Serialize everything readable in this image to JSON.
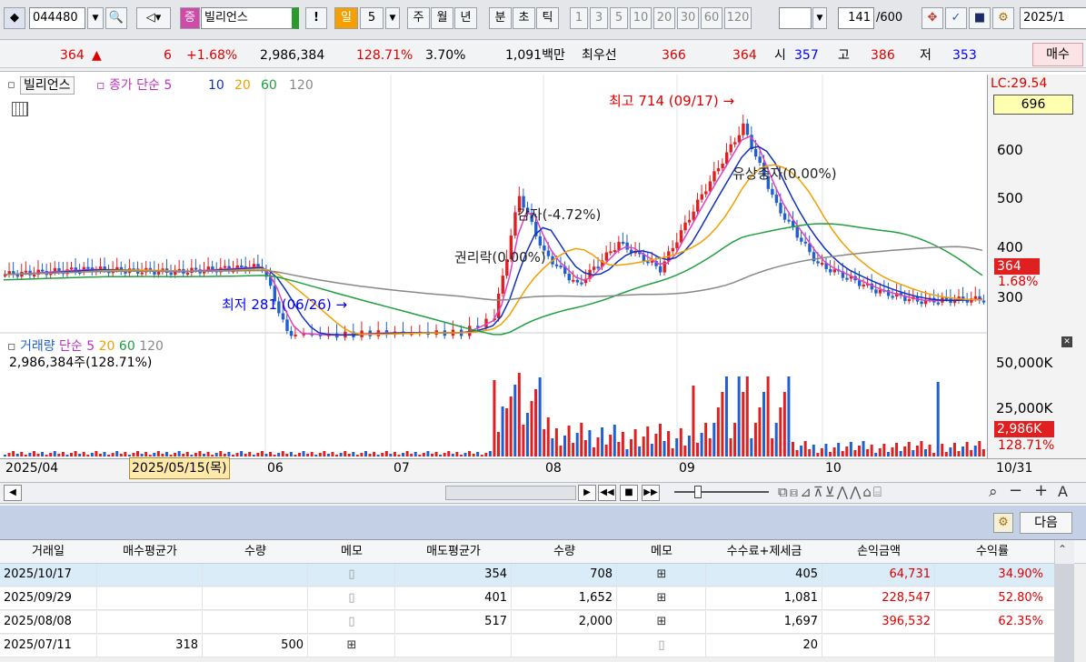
{
  "toolbar": {
    "code": "044480",
    "badge": "증",
    "stock_name": "빌리언스",
    "mark": "!",
    "period_buttons": [
      "일",
      "5",
      "주",
      "월",
      "년",
      "분",
      "초",
      "틱"
    ],
    "minute_buttons": [
      "1",
      "3",
      "5",
      "10",
      "20",
      "30",
      "60",
      "120"
    ],
    "count_value": "141",
    "count_total": "/600",
    "date_value": "2025/1"
  },
  "quote": {
    "price": "364",
    "arrow": "▲",
    "change": "6",
    "change_pct": "+1.68%",
    "volume": "2,986,384",
    "volume_ratio": "128.71%",
    "turnover": "3.70%",
    "amount": "1,091백만",
    "best_label": "최우선",
    "best_ask": "366",
    "best_bid": "364",
    "open_label": "시",
    "open": "357",
    "high_label": "고",
    "high": "386",
    "low_label": "저",
    "low": "353",
    "buy_label": "매수"
  },
  "chart": {
    "price_legend": {
      "name": "빌리언스",
      "ma_label": "종가 단순",
      "ma": [
        "5",
        "10",
        "20",
        "60",
        "120"
      ]
    },
    "lc_label": "LC:29.54",
    "top_value": "696",
    "price_ticks": [
      "600",
      "500",
      "400",
      "300"
    ],
    "current_price_tag": "364",
    "current_pct_tag": "1.68%",
    "annotations": {
      "high": "최고 714 (09/17)",
      "low": "최저 281 (06/26)",
      "capital_reduction": "감자(-4.72%)",
      "ex_rights": "권리락(0.00%)",
      "bonus_issue": "유상증자(0.00%)"
    },
    "volume_legend": {
      "name": "거래량",
      "ma_label": "단순",
      "ma": [
        "5",
        "20",
        "60",
        "120"
      ],
      "summary": "2,986,384주(128.71%)"
    },
    "volume_ticks": [
      "50,000K",
      "25,000K"
    ],
    "volume_tag": "2,986K",
    "volume_pct_tag": "128.71%",
    "date_axis": [
      "2025/04",
      "2025/05/15(목)",
      "06",
      "07",
      "08",
      "09",
      "10",
      "10/31"
    ]
  },
  "chart_data": {
    "type": "candlestick",
    "x": [
      "2025/04",
      "2025/05",
      "2025/06",
      "2025/07",
      "2025/08",
      "2025/09",
      "2025/10"
    ],
    "series": [
      {
        "name": "종가",
        "values": [
          410,
          415,
          300,
          295,
          330,
          550,
          364
        ]
      }
    ],
    "ylim": [
      280,
      720
    ]
  },
  "panel": {
    "next_label": "다음"
  },
  "table": {
    "headers": [
      "거래일",
      "매수평균가",
      "수량",
      "메모",
      "매도평균가",
      "수량",
      "메모",
      "수수료+제세금",
      "손익금액",
      "수익률"
    ],
    "rows": [
      {
        "date": "2025/10/17",
        "buy_avg": "",
        "buy_qty": "",
        "sell_avg": "354",
        "sell_qty": "708",
        "fee": "405",
        "pnl": "64,731",
        "ret": "34.90%"
      },
      {
        "date": "2025/09/29",
        "buy_avg": "",
        "buy_qty": "",
        "sell_avg": "401",
        "sell_qty": "1,652",
        "fee": "1,081",
        "pnl": "228,547",
        "ret": "52.80%"
      },
      {
        "date": "2025/08/08",
        "buy_avg": "",
        "buy_qty": "",
        "sell_avg": "517",
        "sell_qty": "2,000",
        "fee": "1,697",
        "pnl": "396,532",
        "ret": "62.35%"
      },
      {
        "date": "2025/07/11",
        "buy_avg": "318",
        "buy_qty": "500",
        "sell_avg": "",
        "sell_qty": "",
        "fee": "20",
        "pnl": "",
        "ret": ""
      }
    ]
  },
  "colors": {
    "up": "#e02020",
    "down": "#1f5fd0",
    "ma5": "#e040c0",
    "ma10": "#1030c0",
    "ma20": "#f0a000",
    "ma60": "#20a040",
    "ma120": "#888888"
  }
}
